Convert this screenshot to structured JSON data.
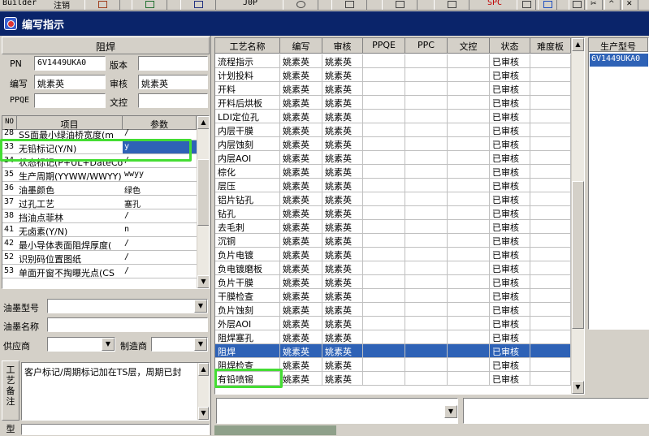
{
  "toolbar": {
    "app_text": "Builder",
    "cancel_label": "注销",
    "jop_label": "J0P",
    "spc_label": "SPC"
  },
  "window": {
    "title": "编写指示"
  },
  "left": {
    "section_title": "阻焊",
    "pn_label": "PN",
    "pn_value": "6V1449UKA0",
    "version_label": "版本",
    "version_value": "",
    "author_label": "编写",
    "author_value": "姚素英",
    "review_label": "审核",
    "review_value": "姚素英",
    "ppqe_label": "PPQE",
    "ppqe_value": "",
    "doc_label": "文控",
    "doc_value": "",
    "params": {
      "headers": [
        "NO",
        "项目",
        "参数"
      ],
      "rows": [
        {
          "no": "28",
          "item": "SS面最小绿油桥宽度(m",
          "value": "/"
        },
        {
          "no": "33",
          "item": "无铅标记(Y/N)",
          "value": "y"
        },
        {
          "no": "34",
          "item": "状态标记(P+UL+DateCo",
          "value": "/"
        },
        {
          "no": "35",
          "item": "生产周期(YYWW/WWYY)",
          "value": "wwyy"
        },
        {
          "no": "36",
          "item": "油墨颜色",
          "value": "绿色"
        },
        {
          "no": "37",
          "item": "过孔工艺",
          "value": "塞孔"
        },
        {
          "no": "38",
          "item": "挡油点菲林",
          "value": "/"
        },
        {
          "no": "41",
          "item": "无卤素(Y/N)",
          "value": "n"
        },
        {
          "no": "42",
          "item": "最小导体表面阻焊厚度(",
          "value": "/"
        },
        {
          "no": "52",
          "item": "识别码位置图纸",
          "value": "/"
        },
        {
          "no": "53",
          "item": "单面开窗不掏曝光点(CS",
          "value": "/"
        }
      ]
    },
    "ink_type_label": "油墨型号",
    "ink_type_value": "",
    "ink_name_label": "油墨名称",
    "ink_name_value": "",
    "supplier_label": "供应商",
    "supplier_value": "",
    "maker_label": "制造商",
    "maker_value": "",
    "remark_label": "工艺备注",
    "remark_text": "客户标记/周期标记加在TS层，周期已封",
    "model_label": "型号"
  },
  "process": {
    "headers": [
      "工艺名称",
      "编写",
      "审核",
      "PPQE",
      "PPC",
      "文控",
      "状态",
      "难度板"
    ],
    "rows": [
      {
        "name": "流程指示",
        "author": "姚素英",
        "reviewer": "姚素英",
        "status": "已审核"
      },
      {
        "name": "计划投料",
        "author": "姚素英",
        "reviewer": "姚素英",
        "status": "已审核"
      },
      {
        "name": "开料",
        "author": "姚素英",
        "reviewer": "姚素英",
        "status": "已审核"
      },
      {
        "name": "开料后烘板",
        "author": "姚素英",
        "reviewer": "姚素英",
        "status": "已审核"
      },
      {
        "name": "LDI定位孔",
        "author": "姚素英",
        "reviewer": "姚素英",
        "status": "已审核"
      },
      {
        "name": "内层干膜",
        "author": "姚素英",
        "reviewer": "姚素英",
        "status": "已审核"
      },
      {
        "name": "内层蚀刻",
        "author": "姚素英",
        "reviewer": "姚素英",
        "status": "已审核"
      },
      {
        "name": "内层AOI",
        "author": "姚素英",
        "reviewer": "姚素英",
        "status": "已审核"
      },
      {
        "name": "棕化",
        "author": "姚素英",
        "reviewer": "姚素英",
        "status": "已审核"
      },
      {
        "name": "层压",
        "author": "姚素英",
        "reviewer": "姚素英",
        "status": "已审核"
      },
      {
        "name": "铝片钻孔",
        "author": "姚素英",
        "reviewer": "姚素英",
        "status": "已审核"
      },
      {
        "name": "钻孔",
        "author": "姚素英",
        "reviewer": "姚素英",
        "status": "已审核"
      },
      {
        "name": "去毛刺",
        "author": "姚素英",
        "reviewer": "姚素英",
        "status": "已审核"
      },
      {
        "name": "沉铜",
        "author": "姚素英",
        "reviewer": "姚素英",
        "status": "已审核"
      },
      {
        "name": "负片电镀",
        "author": "姚素英",
        "reviewer": "姚素英",
        "status": "已审核"
      },
      {
        "name": "负电镀磨板",
        "author": "姚素英",
        "reviewer": "姚素英",
        "status": "已审核"
      },
      {
        "name": "负片干膜",
        "author": "姚素英",
        "reviewer": "姚素英",
        "status": "已审核"
      },
      {
        "name": "干膜检查",
        "author": "姚素英",
        "reviewer": "姚素英",
        "status": "已审核"
      },
      {
        "name": "负片蚀刻",
        "author": "姚素英",
        "reviewer": "姚素英",
        "status": "已审核"
      },
      {
        "name": "外层AOI",
        "author": "姚素英",
        "reviewer": "姚素英",
        "status": "已审核"
      },
      {
        "name": "阻焊塞孔",
        "author": "姚素英",
        "reviewer": "姚素英",
        "status": "已审核"
      },
      {
        "name": "阻焊",
        "author": "姚素英",
        "reviewer": "姚素英",
        "status": "已审核"
      },
      {
        "name": "阻焊检查",
        "author": "姚素英",
        "reviewer": "姚素英",
        "status": "已审核"
      },
      {
        "name": "有铅喷锡",
        "author": "姚素英",
        "reviewer": "姚素英",
        "status": "已审核"
      }
    ]
  },
  "right": {
    "header": "生产型号",
    "row_value": "6V1449UKA0"
  },
  "colors": {
    "title_bar": "#0a246a",
    "selection": "#2e62b6",
    "highlight_box": "#44dd33"
  }
}
